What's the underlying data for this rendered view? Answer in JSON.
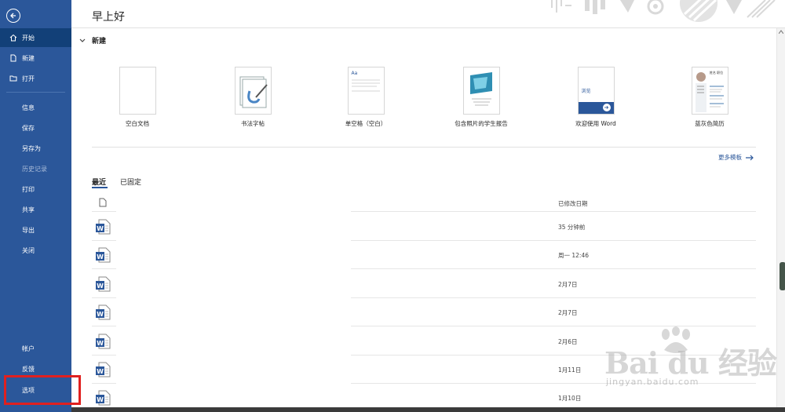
{
  "header": {
    "greeting": "早上好"
  },
  "sidebar": {
    "top_items": [
      {
        "label": "开始",
        "icon": "home-icon"
      },
      {
        "label": "新建",
        "icon": "new-doc-icon"
      },
      {
        "label": "打开",
        "icon": "folder-icon"
      }
    ],
    "mid_items": [
      {
        "label": "信息"
      },
      {
        "label": "保存"
      },
      {
        "label": "另存为"
      },
      {
        "label": "历史记录"
      },
      {
        "label": "打印"
      },
      {
        "label": "共享"
      },
      {
        "label": "导出"
      },
      {
        "label": "关闭"
      }
    ],
    "bottom_items": [
      {
        "label": "帐户"
      },
      {
        "label": "反馈"
      },
      {
        "label": "选项"
      }
    ],
    "accent": "#2b579a",
    "highlight_color": "#e0201f"
  },
  "new_section": {
    "title": "新建",
    "templates": [
      {
        "label": "空白文档"
      },
      {
        "label": "书法字帖"
      },
      {
        "label": "单空格（空白）",
        "thumb_text": "Aa"
      },
      {
        "label": "包含照片的学生报告"
      },
      {
        "label": "欢迎使用 Word",
        "thumb_text": "浏览"
      },
      {
        "label": "蓝灰色简历",
        "thumb_text": "姓名 职位"
      }
    ],
    "more_templates": "更多模板"
  },
  "tabs": [
    {
      "label": "最近"
    },
    {
      "label": "已固定"
    }
  ],
  "file_list": {
    "column_modified": "已修改日期",
    "rows": [
      {
        "date": "35 分钟前"
      },
      {
        "date": "周一 12:46"
      },
      {
        "date": "2月7日"
      },
      {
        "date": "2月7日"
      },
      {
        "date": "2月6日"
      },
      {
        "date": "1月11日"
      },
      {
        "date": "1月10日"
      }
    ]
  },
  "watermark": {
    "main": "Bai du 经验",
    "sub": "jingyan.baidu.com"
  }
}
